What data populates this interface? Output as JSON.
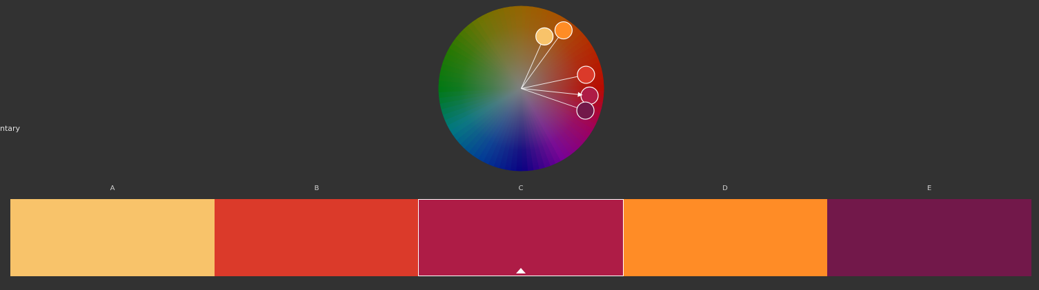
{
  "harmony_rule": {
    "label": "ntary"
  },
  "wheel": {
    "handles": [
      {
        "id": "A",
        "color": "#F8C36A",
        "angle_deg": 24,
        "radius_frac": 0.69,
        "base": false
      },
      {
        "id": "D",
        "color": "#FF8C26",
        "angle_deg": 36,
        "radius_frac": 0.87,
        "base": false
      },
      {
        "id": "B",
        "color": "#DB3A2A",
        "angle_deg": 78,
        "radius_frac": 0.8,
        "base": false
      },
      {
        "id": "C",
        "color": "#AE1C46",
        "angle_deg": 96,
        "radius_frac": 0.83,
        "base": true
      },
      {
        "id": "E",
        "color": "#72184A",
        "angle_deg": 109,
        "radius_frac": 0.82,
        "base": false
      }
    ]
  },
  "swatches": [
    {
      "label": "A",
      "color": "#F8C36A",
      "selected": false
    },
    {
      "label": "B",
      "color": "#DB3A2A",
      "selected": false
    },
    {
      "label": "C",
      "color": "#AE1C46",
      "selected": true
    },
    {
      "label": "D",
      "color": "#FF8C26",
      "selected": false
    },
    {
      "label": "E",
      "color": "#72184A",
      "selected": false
    }
  ]
}
